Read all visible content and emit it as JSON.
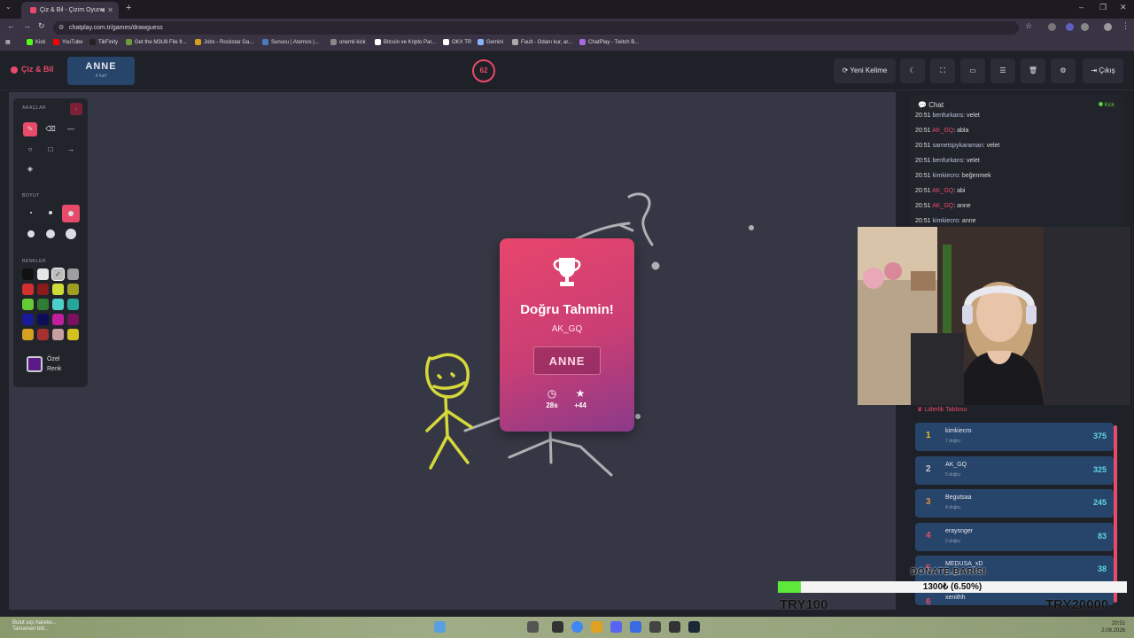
{
  "browser": {
    "tab_title": "Çiz & Bil - Çizim Oyunu",
    "url": "chatplay.com.tr/games/drawguess",
    "bookmarks": [
      "Kick",
      "YouTube",
      "TikFinity",
      "Get the M3U8 File fr...",
      "Jobs - Rockstar Ga...",
      "Sunucu | Aternos |...",
      "onemli kick",
      "Bitcoin ve Kripto Par...",
      "OKX TR",
      "Gemini",
      "Fault - Odanı kur, ar...",
      "ChatPlay - Twitch B..."
    ]
  },
  "app": {
    "brand": "Çiz & Bil",
    "word": "ANNE",
    "word_letters": "4 harf",
    "timer": "62",
    "buttons": {
      "new_word": "Yeni Kelime",
      "exit": "Çıkış"
    }
  },
  "toolbar": {
    "tools_title": "ARAÇLAR",
    "size_title": "BOYUT",
    "colors_title": "RENKLER",
    "custom_color_line1": "Özel",
    "custom_color_line2": "Renk",
    "colors": [
      "#111111",
      "#e6e6e6",
      "#bdbdbd",
      "#9e9e9e",
      "#d32f2f",
      "#8b1a1a",
      "#cddc39",
      "#9e9d24",
      "#66cc33",
      "#2e7d32",
      "#4dd0c8",
      "#26a69a",
      "#1a1a9c",
      "#0d0d5a",
      "#c21e9e",
      "#7a1060",
      "#d4a020",
      "#a83030",
      "#c4a0a0",
      "#d4c020"
    ]
  },
  "guess_card": {
    "title": "Doğru Tahmin!",
    "player": "AK_GQ",
    "word": "ANNE",
    "time": "28s",
    "points": "+44"
  },
  "chat": {
    "title": "Chat",
    "platform": "Kick",
    "messages": [
      {
        "time": "20:51",
        "user": "benfurkans",
        "text": ": velet",
        "red": false
      },
      {
        "time": "20:51",
        "user": "AK_GQ",
        "text": ": abla",
        "red": true
      },
      {
        "time": "20:51",
        "user": "sametspykaraman",
        "text": ": velet",
        "red": false
      },
      {
        "time": "20:51",
        "user": "benfurkans",
        "text": ": velet",
        "red": false
      },
      {
        "time": "20:51",
        "user": "kimkiecro",
        "text": ": beğenmek",
        "red": false
      },
      {
        "time": "20:51",
        "user": "AK_GQ",
        "text": ": abi",
        "red": true
      },
      {
        "time": "20:51",
        "user": "AK_GQ",
        "text": ": anne",
        "red": true
      },
      {
        "time": "20:51",
        "user": "kimkiecro",
        "text": ": anne",
        "red": false
      }
    ]
  },
  "leaderboard": {
    "title": "Liderlik Tablosu",
    "rows": [
      {
        "rank": "1",
        "name": "kimkiecro",
        "sub": "7 doğru",
        "score": "375",
        "color": "#f0c020"
      },
      {
        "rank": "2",
        "name": "AK_GQ",
        "sub": "5 doğru",
        "score": "325",
        "color": "#c8ccd6"
      },
      {
        "rank": "3",
        "name": "Begutsaa",
        "sub": "4 doğru",
        "score": "245",
        "color": "#e09040"
      },
      {
        "rank": "4",
        "name": "eraysnger",
        "sub": "2 doğru",
        "score": "83",
        "color": "#e84a6a"
      },
      {
        "rank": "5",
        "name": "MEDUSA_xD",
        "sub": "1 doğru",
        "score": "38",
        "color": "#e84a6a"
      },
      {
        "rank": "6",
        "name": "xenithh",
        "sub": "",
        "score": "",
        "color": "#e84a6a"
      }
    ]
  },
  "donation": {
    "title": "DONATE BARISI",
    "progress_text": "1300₺ (6.50%)",
    "progress_fraction": 0.065,
    "min": "TRY100",
    "max": "TRY20000"
  },
  "taskbar": {
    "weather_line1": "Bulut sıçı hareke...",
    "weather_line2": "Tamamen bitt...",
    "time": "20:51",
    "date": "2.08.2026"
  }
}
